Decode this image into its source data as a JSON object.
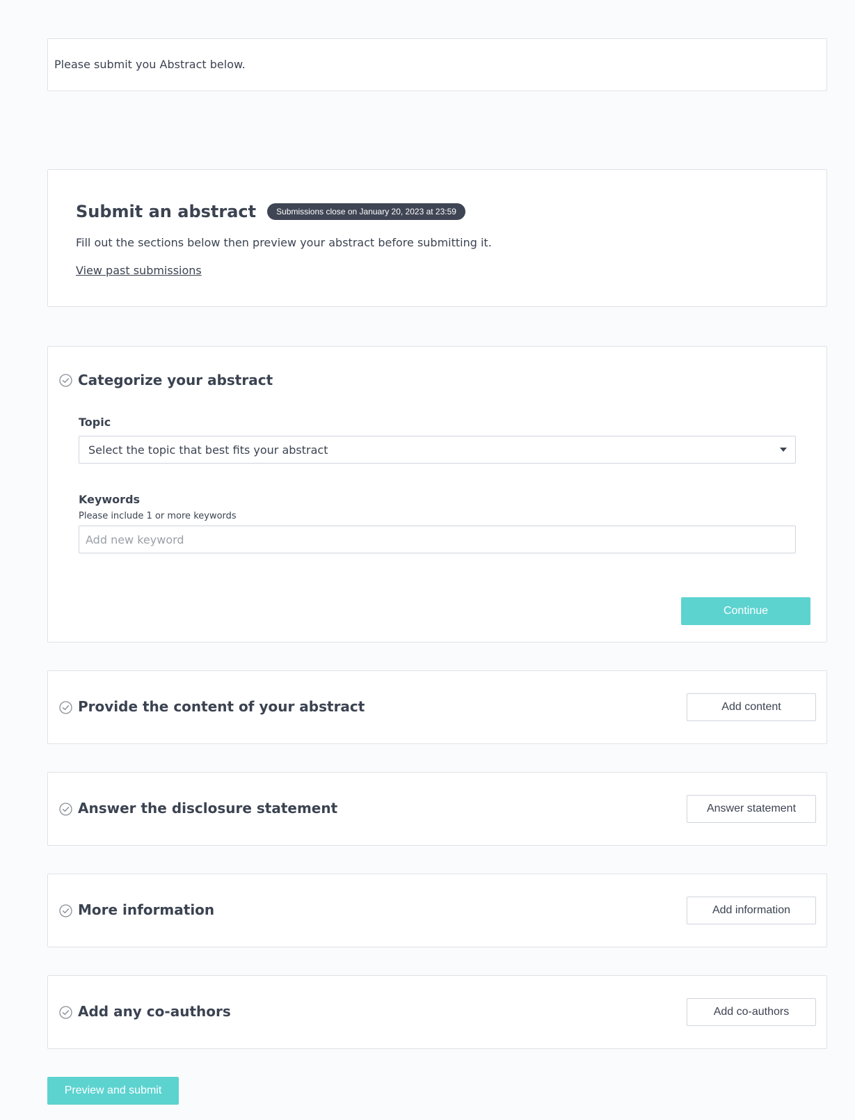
{
  "notice": {
    "text": "Please submit you Abstract below."
  },
  "header": {
    "title": "Submit an abstract",
    "deadline_badge": "Submissions close on January 20, 2023 at 23:59",
    "description": "Fill out the sections below then preview your abstract before submitting it.",
    "past_link": "View past submissions"
  },
  "categorize": {
    "title": "Categorize your abstract",
    "topic_label": "Topic",
    "topic_placeholder": "Select the topic that best fits your abstract",
    "keywords_label": "Keywords",
    "keywords_hint": "Please include 1 or more keywords",
    "keyword_placeholder": "Add new keyword",
    "continue_label": "Continue"
  },
  "steps": [
    {
      "title": "Provide the content of your abstract",
      "button": "Add content"
    },
    {
      "title": "Answer the disclosure statement",
      "button": "Answer statement"
    },
    {
      "title": "More information",
      "button": "Add information"
    },
    {
      "title": "Add any co-authors",
      "button": "Add co-authors"
    }
  ],
  "preview_label": "Preview and submit",
  "colors": {
    "accent": "#5dd3d0",
    "badge_bg": "#3f4554",
    "text": "#3b4351",
    "border": "#dfe2e6",
    "background": "#fafbfc"
  },
  "icons": {
    "step_status": "check-circle-icon",
    "select_caret": "caret-down-icon"
  }
}
